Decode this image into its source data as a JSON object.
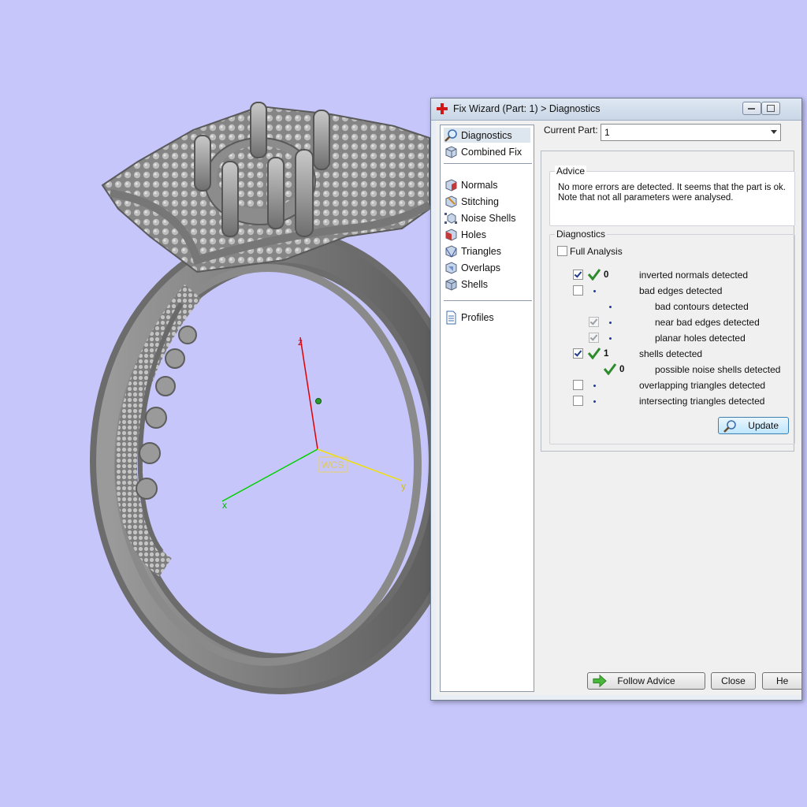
{
  "window": {
    "title": "Fix Wizard (Part: 1) > Diagnostics"
  },
  "viewport": {
    "axes": {
      "z": "z",
      "x": "x",
      "y": "y",
      "origin_label": "WCS"
    },
    "background": "#c6c6fb"
  },
  "nav": {
    "items": [
      {
        "label": "Diagnostics",
        "icon": "magnifier-icon",
        "selected": true
      },
      {
        "label": "Combined Fix",
        "icon": "cube-icon"
      },
      {
        "label": "Normals",
        "icon": "normals-cube-icon"
      },
      {
        "label": "Stitching",
        "icon": "stitching-cube-icon"
      },
      {
        "label": "Noise Shells",
        "icon": "noise-shells-icon"
      },
      {
        "label": "Holes",
        "icon": "holes-cube-icon"
      },
      {
        "label": "Triangles",
        "icon": "triangles-cube-icon"
      },
      {
        "label": "Overlaps",
        "icon": "overlaps-cube-icon"
      },
      {
        "label": "Shells",
        "icon": "shells-cube-icon"
      },
      {
        "label": "Profiles",
        "icon": "document-icon"
      }
    ]
  },
  "current_part": {
    "label": "Current Part:",
    "value": "1"
  },
  "advice": {
    "title": "Advice",
    "text": "No more errors are detected. It seems that the part is ok.\nNote that not all parameters were analysed."
  },
  "diagnostics": {
    "title": "Diagnostics",
    "full_analysis": {
      "label": "Full Analysis",
      "checked": false
    },
    "rows": [
      {
        "label": "inverted normals detected",
        "checked": true,
        "result": "check",
        "count": "0"
      },
      {
        "label": "bad edges detected",
        "checked": false,
        "result": "dot"
      },
      {
        "label": "bad contours detected",
        "result": "dot",
        "indent": true
      },
      {
        "label": "near bad edges detected",
        "checked": true,
        "disabled": true,
        "result": "dot",
        "indent": true
      },
      {
        "label": "planar holes detected",
        "checked": true,
        "disabled": true,
        "result": "dot",
        "indent": true
      },
      {
        "label": "shells detected",
        "checked": true,
        "result": "check",
        "count": "1"
      },
      {
        "label": "possible noise shells detected",
        "result": "check",
        "count": "0",
        "indent": true
      },
      {
        "label": "overlapping triangles detected",
        "checked": false,
        "result": "dot"
      },
      {
        "label": "intersecting triangles detected",
        "checked": false,
        "result": "dot"
      }
    ],
    "update_label": "Update"
  },
  "buttons": {
    "follow_advice": "Follow Advice",
    "close": "Close",
    "help": "He"
  }
}
